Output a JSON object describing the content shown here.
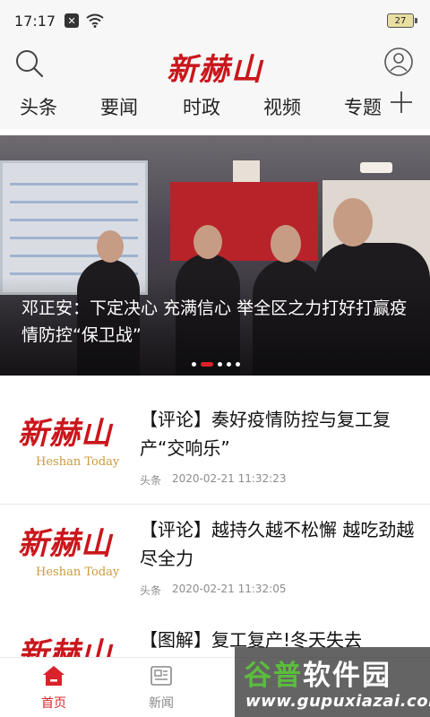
{
  "status_bar": {
    "time": "17:17",
    "battery": "27"
  },
  "header": {
    "logo": "新赫山"
  },
  "tabs": [
    {
      "label": "头条"
    },
    {
      "label": "要闻"
    },
    {
      "label": "时政"
    },
    {
      "label": "视频"
    },
    {
      "label": "专题"
    }
  ],
  "banner": {
    "caption": "邓正安：下定决心 充满信心 举全区之力打好打赢疫情防控“保卫战”",
    "slide_count": 5,
    "active_slide": 2
  },
  "news": [
    {
      "title": "【评论】奏好疫情防控与复工复产“交响乐”",
      "category": "头条",
      "time": "2020-02-21 11:32:23",
      "thumb_cn": "新赫山",
      "thumb_en": "Heshan Today"
    },
    {
      "title": "【评论】越持久越不松懈 越吃劲越尽全力",
      "category": "头条",
      "time": "2020-02-21 11:32:05",
      "thumb_cn": "新赫山",
      "thumb_en": "Heshan Today"
    },
    {
      "title": "【图解】复工复产!冬天失去",
      "category": "",
      "time": "",
      "thumb_cn": "新赫山",
      "thumb_en": ""
    }
  ],
  "bottom_nav": [
    {
      "label": "首页",
      "icon": "home-icon",
      "active": true
    },
    {
      "label": "新闻",
      "icon": "news-icon",
      "active": false
    }
  ],
  "watermark": {
    "name_a": "谷普",
    "name_b": "软件园",
    "url": "www.gupuxiazai.com"
  },
  "colors": {
    "brand_red": "#d9232a",
    "logo_red": "#c9161c",
    "meta_gray": "#8c8c8c"
  }
}
